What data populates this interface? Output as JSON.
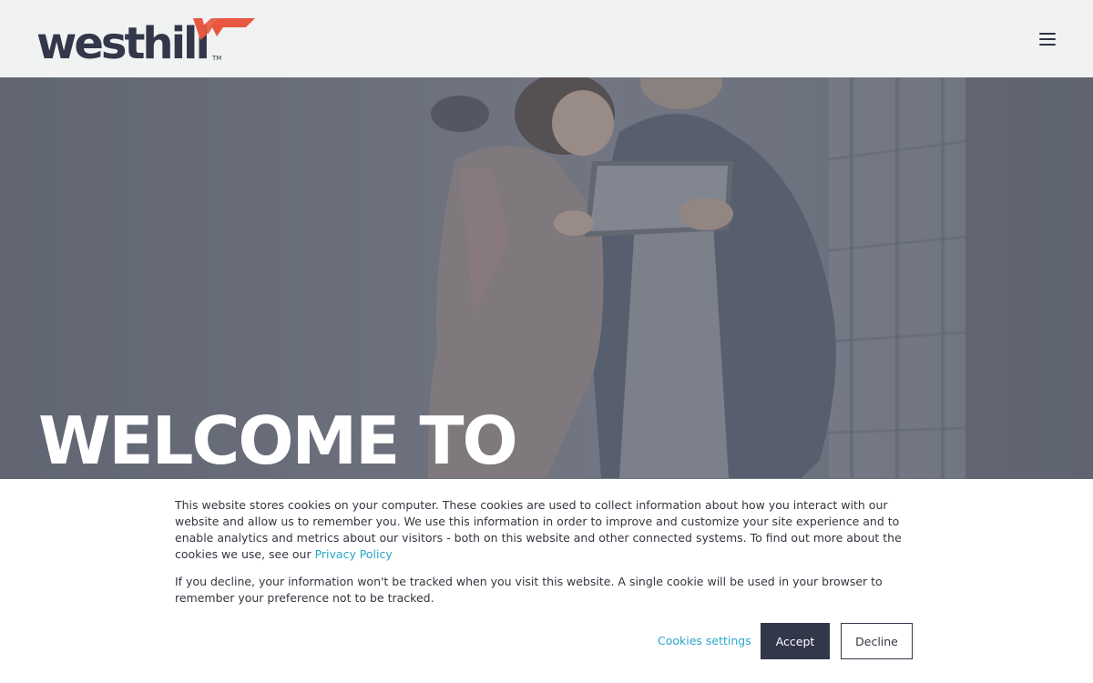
{
  "header": {
    "logo_text": "westhill",
    "logo_trademark": "TM",
    "menu_icon": "hamburger-menu-icon"
  },
  "hero": {
    "title": "WELCOME TO",
    "image_icon": "people-with-tablet-photo"
  },
  "cookie_banner": {
    "paragraph1": "This website stores cookies on your computer. These cookies are used to collect information about how you interact with our website and allow us to remember you. We use this information in order to improve and customize your site experience and to enable analytics and metrics about our visitors - both on this website and other connected systems. To find out more about the cookies we use, see our ",
    "privacy_link": "Privacy Policy",
    "paragraph2": "If you decline, your information won't be tracked when you visit this website. A single cookie will be used in your browser to remember your preference not to be tracked.",
    "settings_label": "Cookies settings",
    "accept_label": "Accept",
    "decline_label": "Decline"
  },
  "colors": {
    "brand_dark": "#33374a",
    "brand_accent": "#e8573f",
    "link": "#2aa7c9",
    "header_bg": "#f1f2f2"
  }
}
